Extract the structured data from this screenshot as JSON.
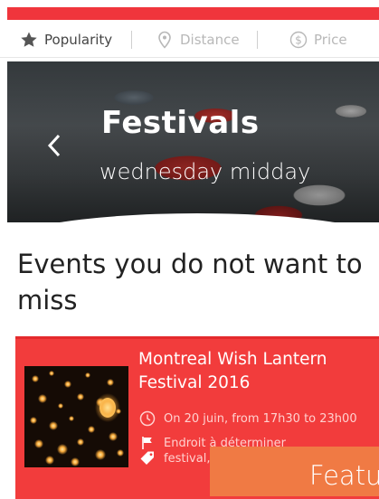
{
  "sort": {
    "popularity_label": "Popularity",
    "distance_label": "Distance",
    "price_label": "Price",
    "popularity_icon": "star-icon",
    "distance_icon": "map-pin-icon",
    "price_icon": "dollar-circle-icon"
  },
  "hero": {
    "title": "Festivals",
    "subtitle": "wednesday midday",
    "back_icon": "chevron-left-icon"
  },
  "section": {
    "title": "Events you do not want to miss"
  },
  "event": {
    "title": "Montreal Wish Lantern Festival 2016",
    "time": "On 20 juin, from 17h30 to 23h00",
    "place": "Endroit à déterminer",
    "tags": "festival,",
    "time_icon": "clock-icon",
    "place_icon": "flag-icon",
    "tags_icon": "tag-icon"
  },
  "featured": {
    "label": "Featu"
  },
  "colors": {
    "accent": "#f0353c",
    "card": "#f23c3c",
    "featured": "#f07a44"
  }
}
